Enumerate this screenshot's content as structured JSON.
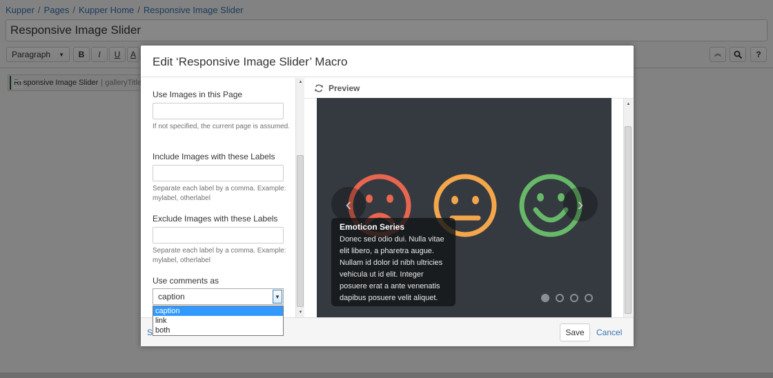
{
  "breadcrumbs": [
    "Kupper",
    "Pages",
    "Kupper Home",
    "Responsive Image Slider"
  ],
  "page_title": "Responsive Image Slider",
  "toolbar": {
    "paragraph_label": "Paragraph",
    "bold": "B",
    "italic": "I",
    "underline": "U",
    "color": "A",
    "collapse_icon": "chevrons-up-icon",
    "search_icon": "search-icon",
    "help": "?"
  },
  "macro_chip": {
    "name": "Responsive Image Slider",
    "params": "| galleryTitle"
  },
  "dialog": {
    "title": "Edit ‘Responsive Image Slider’ Macro",
    "preview_label": "Preview",
    "save_label": "Save",
    "cancel_label": "Cancel",
    "select_macro_label": "S",
    "params": [
      {
        "label": "Use Images in this Page",
        "value": "",
        "help": "If not specified, the current page is assumed."
      },
      {
        "label": "Include Images with these Labels",
        "value": "",
        "help": "Separate each label by a comma. Example: mylabel, otherlabel"
      },
      {
        "label": "Exclude Images with these Labels",
        "value": "",
        "help": "Separate each label by a comma. Example: mylabel, otherlabel"
      }
    ],
    "comments": {
      "label": "Use comments as",
      "selected": "caption",
      "options": [
        "caption",
        "link",
        "both"
      ]
    }
  },
  "slider": {
    "caption_title": "Emoticon Series",
    "caption_body": "Donec sed odio dui. Nulla vitae elit libero, a pharetra augue. Nullam id dolor id nibh ultricies vehicula ut id elit. Integer posuere erat a ante venenatis dapibus posuere velit aliquet.",
    "slide_count": 4,
    "active_slide": 1,
    "prev_icon": "chevron-left-icon",
    "next_icon": "chevron-right-icon",
    "faces": [
      {
        "mood": "sad",
        "color": "#e8654f"
      },
      {
        "mood": "neutral",
        "color": "#f4a64a"
      },
      {
        "mood": "happy",
        "color": "#67b869"
      }
    ],
    "background": "#343a40"
  }
}
